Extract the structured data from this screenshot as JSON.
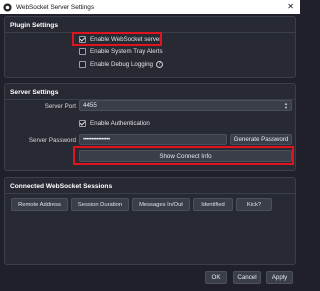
{
  "window": {
    "title": "WebSocket Server Settings",
    "close_glyph": "✕"
  },
  "plugin": {
    "header": "Plugin Settings",
    "enable_server": {
      "label": "Enable WebSocket server",
      "checked": true
    },
    "tray_alerts": {
      "label": "Enable System Tray Alerts",
      "checked": false
    },
    "debug_logging": {
      "label": "Enable Debug Logging",
      "checked": false,
      "help_glyph": "?"
    }
  },
  "server": {
    "header": "Server Settings",
    "port_label": "Server Port",
    "port_value": "4455",
    "auth": {
      "label": "Enable Authentication",
      "checked": true
    },
    "password_label": "Server Password",
    "password_value": "••••••••••••••••",
    "generate_label": "Generate Password",
    "show_connect_label": "Show Connect Info"
  },
  "sessions": {
    "header": "Connected WebSocket Sessions",
    "columns": [
      "Remote Address",
      "Session Duration",
      "Messages In/Out",
      "Identified",
      "Kick?"
    ]
  },
  "footer": {
    "ok": "OK",
    "cancel": "Cancel",
    "apply": "Apply"
  },
  "colors": {
    "background": "#1f2029",
    "panel": "#272a33",
    "highlight": "#e0141e",
    "button": "#3a3e48"
  },
  "icons": [
    "app-icon",
    "close-icon",
    "checkbox-checked-icon",
    "help-icon",
    "spinner-icon"
  ]
}
